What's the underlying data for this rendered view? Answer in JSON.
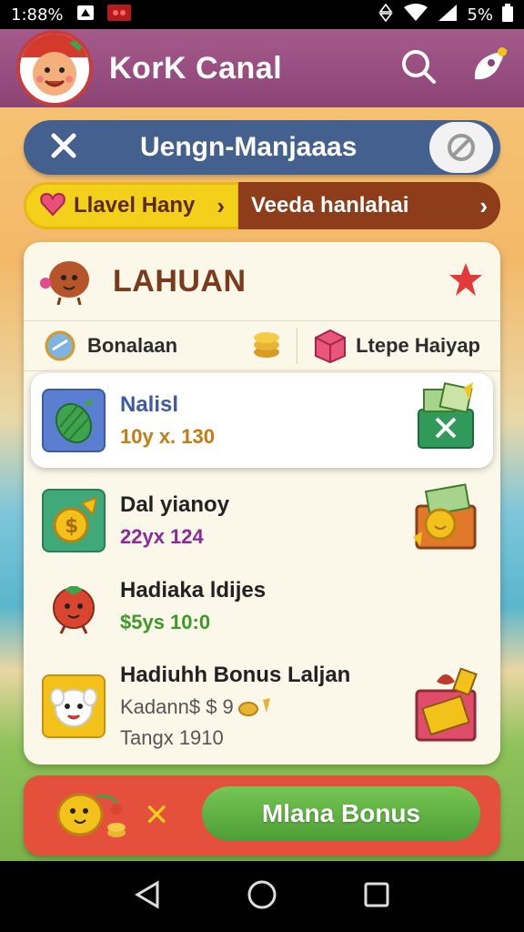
{
  "status": {
    "time": "1:88%",
    "battery": "5%"
  },
  "app": {
    "title": "KorK Canal"
  },
  "search": {
    "label": "Uengn-Manjaaas"
  },
  "pills": {
    "left_label": "Llavel Hany",
    "right_label": "Veeda hanlahai"
  },
  "card": {
    "title": "LAHUAN",
    "tabs": {
      "left_label": "Bonalaan",
      "right_label": "Ltepe Haiyap"
    },
    "rows": [
      {
        "title": "Nalisl",
        "subtitle": "10y x. 130",
        "subtitle_color": "#c57a12"
      },
      {
        "title": "Dal yianoy",
        "subtitle": "22yx 124",
        "subtitle_color": "#8c2a9a"
      },
      {
        "title": "Hadiaka ldijes",
        "subtitle": "$5ys 10:0",
        "subtitle_color": "#3d9a2a"
      },
      {
        "title": "Hadiuhh Bonus Laljan",
        "subtitle": "Kadann$ $ 9",
        "line3": "Tangx 1910"
      }
    ]
  },
  "footer": {
    "close_symbol": "✕",
    "button_label": "Mlana Bonus"
  },
  "colors": {
    "appbar": "#8b4376",
    "search": "#44608f",
    "accent_yellow": "#f3d11a",
    "accent_brown": "#8e3d1a",
    "footer": "#e4503b",
    "bonus": "#4d9e37"
  }
}
